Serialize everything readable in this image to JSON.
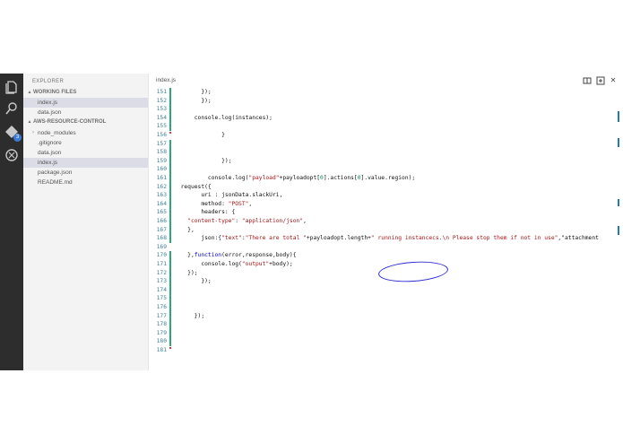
{
  "activity": {
    "git_badge": "3"
  },
  "sidebar": {
    "title": "EXPLORER",
    "working_files": {
      "header": "WORKING FILES",
      "items": [
        "index.js",
        "data.json"
      ]
    },
    "project": {
      "header": "AWS-RESOURCE-CONTROL",
      "items": [
        "node_modules",
        ".gitignore",
        "data.json",
        "index.js",
        "package.json",
        "README.md"
      ]
    }
  },
  "editor": {
    "tab_label": "index.js",
    "lines": [
      {
        "n": "151",
        "t": "        });"
      },
      {
        "n": "152",
        "t": "        });"
      },
      {
        "n": "153",
        "t": ""
      },
      {
        "n": "154",
        "t": "      console.log(instances);"
      },
      {
        "n": "155",
        "t": ""
      },
      {
        "n": "156",
        "t": "              }"
      },
      {
        "n": "157",
        "t": ""
      },
      {
        "n": "158",
        "t": ""
      },
      {
        "n": "159",
        "t": "              });"
      },
      {
        "n": "160",
        "t": ""
      },
      {
        "n": "161",
        "t": "          console.log(\"payload\"+payloadopt[0].actions[0].value.region);"
      },
      {
        "n": "162",
        "t": "  request({"
      },
      {
        "n": "163",
        "t": "        uri : jsonData.slackUri,"
      },
      {
        "n": "164",
        "t": "        method: \"POST\","
      },
      {
        "n": "165",
        "t": "        headers: {"
      },
      {
        "n": "166",
        "t": "    \"content-type\": \"application/json\","
      },
      {
        "n": "167",
        "t": "    },"
      },
      {
        "n": "168",
        "t": "        json:{\"text\":\"There are total \"+payloadopt.length+\" running instancecs.\\n Please stop them if not in use\",\"attachment"
      },
      {
        "n": "169",
        "t": ""
      },
      {
        "n": "170",
        "t": "    },function(error,response,body){"
      },
      {
        "n": "171",
        "t": "        console.log(\"output\"+body);"
      },
      {
        "n": "172",
        "t": "    });"
      },
      {
        "n": "173",
        "t": "        });"
      },
      {
        "n": "174",
        "t": ""
      },
      {
        "n": "175",
        "t": ""
      },
      {
        "n": "176",
        "t": ""
      },
      {
        "n": "177",
        "t": "      });"
      },
      {
        "n": "178",
        "t": ""
      },
      {
        "n": "179",
        "t": ""
      },
      {
        "n": "180",
        "t": ""
      },
      {
        "n": "181",
        "t": ""
      }
    ]
  },
  "colors": {
    "activity_bg": "#2d2d2d",
    "sidebar_bg": "#f3f3f3",
    "selection": "#dcdce6",
    "line_number": "#3d7f9d",
    "string": "#a31515",
    "gutter_added": "#2aa876"
  }
}
